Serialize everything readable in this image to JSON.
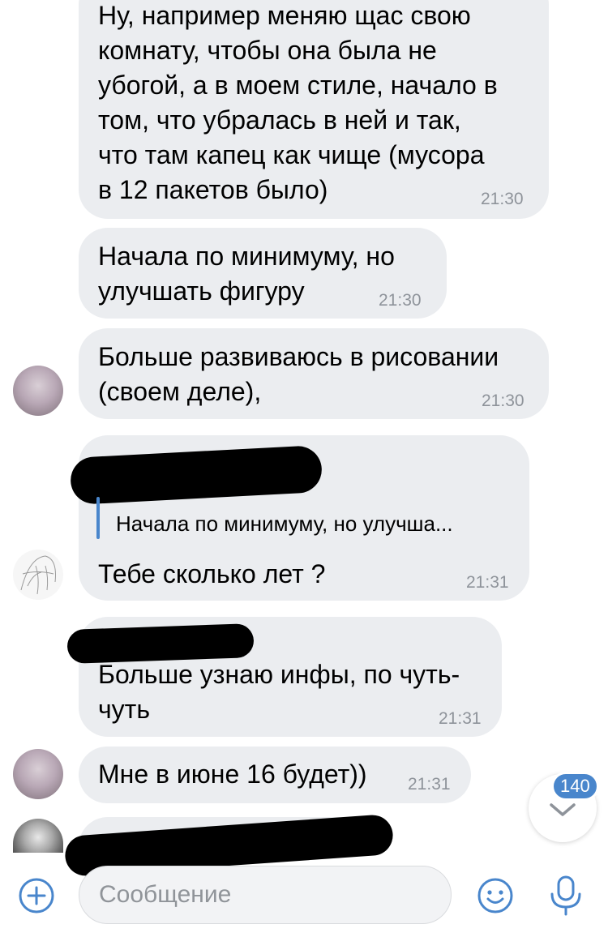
{
  "messages": [
    {
      "text": "Ну, например меняю щас свою\nкомнату, чтобы она была не\nубогой, а в моем стиле, начало в\nтом, что убралась в ней и так,\nчто там капец как чище (мусора\nв 12 пакетов было)",
      "time": "21:30"
    },
    {
      "text": "Начала по минимуму, но\nулучшать фигуру",
      "time": "21:30"
    },
    {
      "text": "Больше развиваюсь в рисовании\n(своем деле),",
      "time": "21:30"
    },
    {
      "reply_quote": "Начала по минимуму, но улучша...",
      "text": "Тебе сколько лет ?",
      "time": "21:31"
    },
    {
      "text": "Больше узнаю инфы, по чуть-\nчуть",
      "time": "21:31"
    },
    {
      "text": "Мне в июне 16 будет))",
      "time": "21:31"
    }
  ],
  "scroll_badge": {
    "count": "140"
  },
  "composer": {
    "placeholder": "Сообщение",
    "add_icon": "plus-circle-icon",
    "emoji_icon": "smile-icon",
    "voice_icon": "microphone-icon"
  },
  "colors": {
    "bubble": "#ebedf0",
    "accent": "#4986cc",
    "time": "#8e939a"
  }
}
